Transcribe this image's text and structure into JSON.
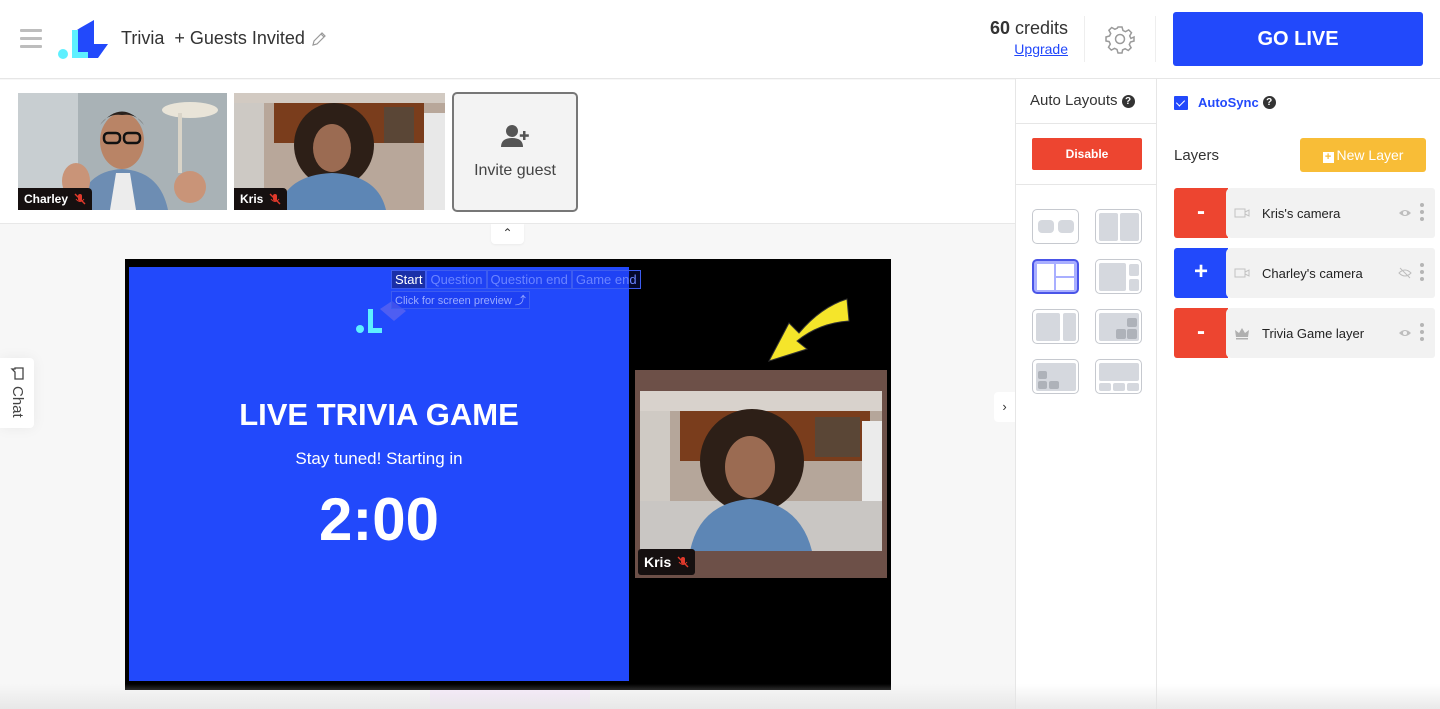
{
  "header": {
    "menu_icon": "hamburger-menu-icon",
    "logo": "brand-logo",
    "title": "Trivia  + Guests Invited",
    "edit_icon": "pencil-icon",
    "credits_count": "60",
    "credits_label": "credits",
    "upgrade_label": "Upgrade",
    "settings_icon": "gear-icon",
    "go_live_label": "GO LIVE",
    "accent_color": "#2249fb"
  },
  "guests": {
    "tiles": [
      {
        "name": "Charley",
        "mic": "muted"
      },
      {
        "name": "Kris",
        "mic": "muted"
      }
    ],
    "invite_label": "Invite guest",
    "invite_icon": "add-user-icon",
    "collapse_icon": "chevron-up-icon"
  },
  "chat": {
    "label": "Chat",
    "icon": "chat-bubble-icon"
  },
  "stage": {
    "scene_tabs": [
      {
        "label": "Start",
        "active": true
      },
      {
        "label": "Question",
        "active": false
      },
      {
        "label": "Question end",
        "active": false
      },
      {
        "label": "Game end",
        "active": false
      }
    ],
    "preview_hint": "Click for screen preview ⤴",
    "game_title": "LIVE TRIVIA GAME",
    "game_subtitle": "Stay tuned! Starting in",
    "countdown": "2:00",
    "featured_guest": {
      "name": "Kris",
      "mic": "muted"
    },
    "game_bg_color": "#2249fb",
    "arrow_color": "#f5e52a"
  },
  "expand_icon": "chevron-right-icon",
  "auto_layouts": {
    "title": "Auto Layouts",
    "help": "?",
    "disable_label": "Disable",
    "options": [
      {
        "name": "two-side-by-side",
        "active": false
      },
      {
        "name": "split-halves",
        "active": false
      },
      {
        "name": "one-plus-two-grid",
        "active": true
      },
      {
        "name": "main-plus-two-side",
        "active": false
      },
      {
        "name": "large-left-small-right",
        "active": false
      },
      {
        "name": "main-plus-three-corner",
        "active": false
      },
      {
        "name": "main-plus-three-left-corner",
        "active": false
      },
      {
        "name": "main-plus-three-bottom",
        "active": false
      }
    ]
  },
  "layers": {
    "autosync_label": "AutoSync",
    "autosync_checked": true,
    "help": "?",
    "title": "Layers",
    "new_layer_label": "New Layer",
    "items": [
      {
        "name": "Kris's camera",
        "action": "-",
        "action_type": "remove",
        "type_icon": "video-camera-icon",
        "visibility": "visible"
      },
      {
        "name": "Charley's camera",
        "action": "+",
        "action_type": "add",
        "type_icon": "video-camera-icon",
        "visibility": "hidden"
      },
      {
        "name": "Trivia Game layer",
        "action": "-",
        "action_type": "remove",
        "type_icon": "crown-icon",
        "visibility": "visible"
      }
    ]
  }
}
